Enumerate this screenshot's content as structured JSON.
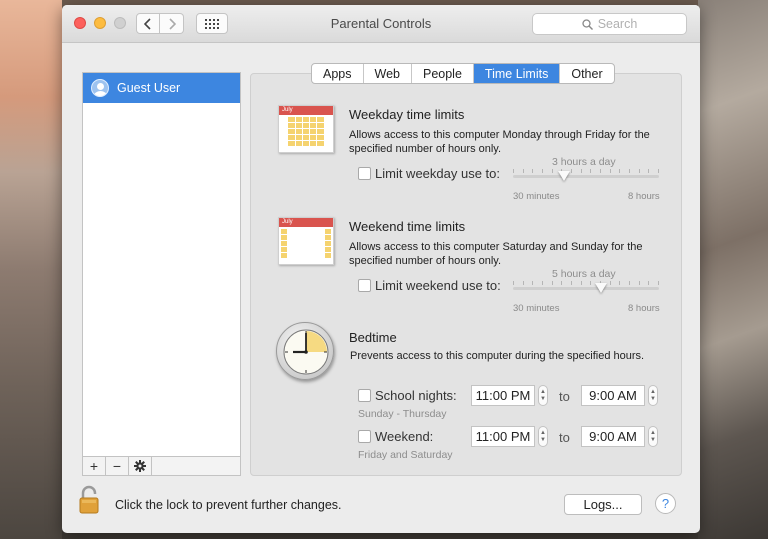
{
  "window": {
    "title": "Parental Controls",
    "search_placeholder": "Search"
  },
  "sidebar": {
    "users": [
      {
        "label": "Guest User",
        "selected": true
      }
    ],
    "footer_buttons": [
      "+",
      "−",
      "gear-icon"
    ]
  },
  "tabs": [
    {
      "label": "Apps",
      "active": false
    },
    {
      "label": "Web",
      "active": false
    },
    {
      "label": "People",
      "active": false
    },
    {
      "label": "Time Limits",
      "active": true
    },
    {
      "label": "Other",
      "active": false
    }
  ],
  "weekday": {
    "calendar_month": "July",
    "title": "Weekday time limits",
    "description": "Allows access to this computer Monday through Friday for the specified number of hours only.",
    "checkbox_label": "Limit weekday use to:",
    "checked": false,
    "value_label": "3 hours a day",
    "min_label": "30 minutes",
    "max_label": "8 hours",
    "value_fraction": 0.35
  },
  "weekend": {
    "calendar_month": "July",
    "title": "Weekend time limits",
    "description": "Allows access to this computer Saturday and Sunday for the specified number of hours only.",
    "checkbox_label": "Limit weekend use to:",
    "checked": false,
    "value_label": "5 hours a day",
    "min_label": "30 minutes",
    "max_label": "8 hours",
    "value_fraction": 0.6
  },
  "bedtime": {
    "title": "Bedtime",
    "description": "Prevents access to this computer during the specified hours.",
    "to_label": "to",
    "school_nights": {
      "label": "School nights:",
      "sublabel": "Sunday - Thursday",
      "from": "11:00 PM",
      "to": "9:00 AM",
      "checked": false
    },
    "weekend": {
      "label": "Weekend:",
      "sublabel": "Friday and Saturday",
      "from": "11:00 PM",
      "to": "9:00 AM",
      "checked": false
    }
  },
  "footer": {
    "lock_text": "Click the lock to prevent further changes.",
    "logs_button": "Logs...",
    "help_button": "?"
  },
  "colors": {
    "accent": "#3d86e0",
    "calendar_header": "#d9544e",
    "calendar_highlight": "#f5d36f"
  }
}
